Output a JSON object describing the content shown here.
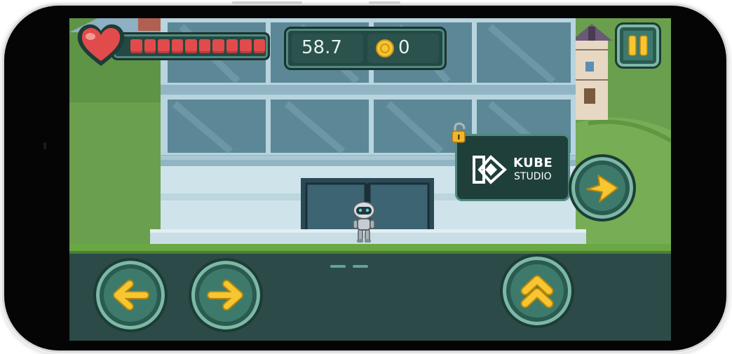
{
  "hud": {
    "timer": "58.7",
    "coins": "0",
    "health_segments_filled": 10,
    "health_segments_total": 10
  },
  "sign": {
    "brand_line1": "KUBE",
    "brand_line2": "STUDIO"
  },
  "icons": {
    "heart": "heart-icon",
    "coin": "coin-icon",
    "pause": "pause-icon",
    "lock": "padlock-icon",
    "arrow_left": "arrow-left-icon",
    "arrow_right": "arrow-right-icon",
    "jump": "double-chevron-up-icon",
    "enter": "arrow-right-icon"
  },
  "colors": {
    "accent_yellow": "#f7c630",
    "hud_teal": "#234944",
    "health_red": "#e24b4b"
  }
}
